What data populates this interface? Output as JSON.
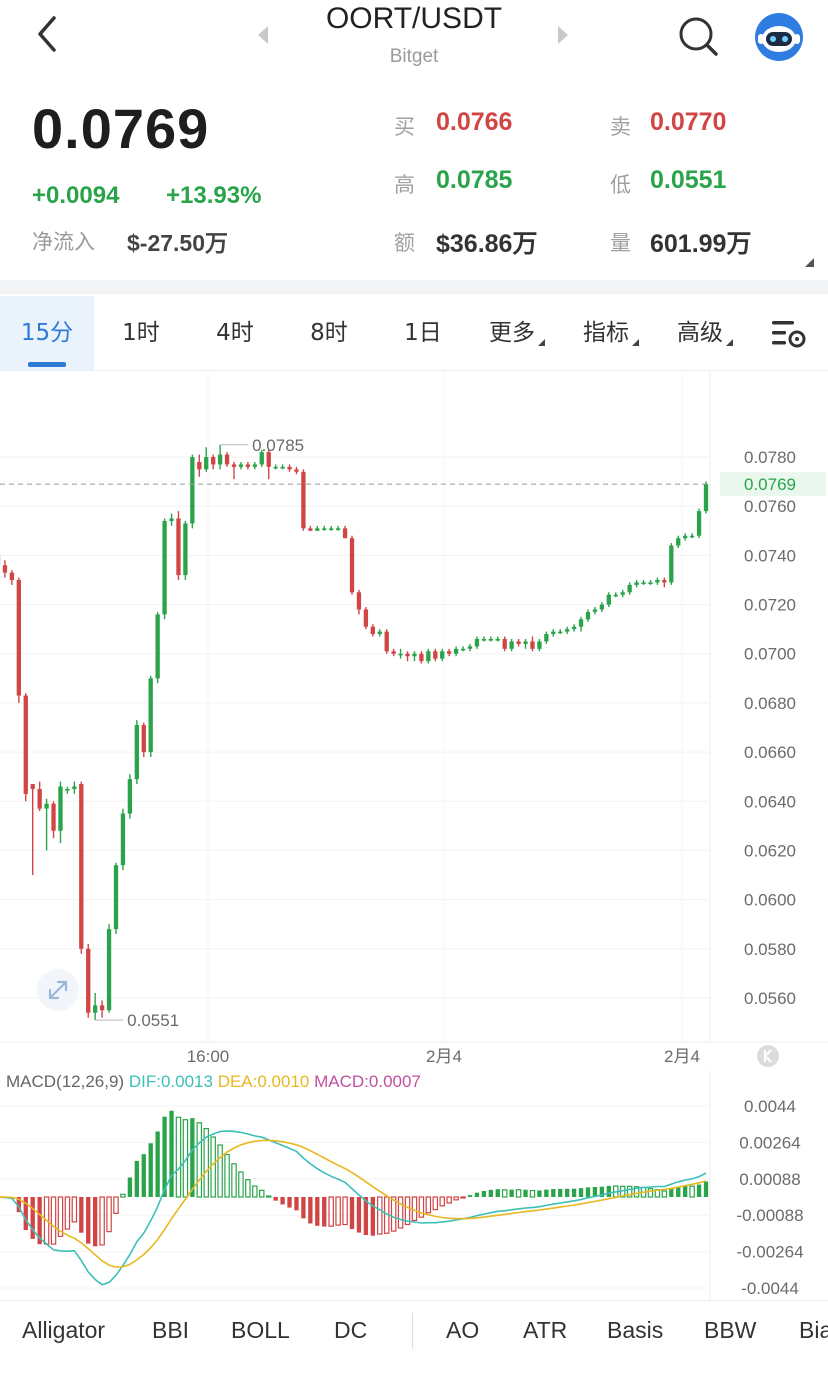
{
  "header": {
    "title": "OORT/USDT",
    "exchange": "Bitget"
  },
  "ticker": {
    "last_price": "0.0769",
    "change_abs": "+0.0094",
    "change_pct": "+13.93%",
    "netflow_label": "净流入",
    "netflow_value": "$-27.50万",
    "bid_label": "买",
    "bid_value": "0.0766",
    "ask_label": "卖",
    "ask_value": "0.0770",
    "high_label": "高",
    "high_value": "0.0785",
    "low_label": "低",
    "low_value": "0.0551",
    "turnover_label": "额",
    "turnover_value": "$36.86万",
    "volume_label": "量",
    "volume_value": "601.99万"
  },
  "tabs": [
    {
      "label": "15分",
      "active": true
    },
    {
      "label": "1时"
    },
    {
      "label": "4时"
    },
    {
      "label": "8时"
    },
    {
      "label": "1日"
    },
    {
      "label": "更多"
    },
    {
      "label": "指标"
    },
    {
      "label": "高级"
    }
  ],
  "colors": {
    "up": "#2aa44a",
    "down": "#d14545",
    "accent": "#2e7bd6",
    "dif": "#3cbfb8",
    "dea": "#e8b820",
    "macd": "#c050a0"
  },
  "chart_data": [
    {
      "type": "candlestick",
      "y_ticks": [
        "0.0780",
        "0.0760",
        "0.0740",
        "0.0720",
        "0.0700",
        "0.0680",
        "0.0660",
        "0.0640",
        "0.0620",
        "0.0600",
        "0.0580",
        "0.0560"
      ],
      "x_ticks": [
        "16:00",
        "2月4",
        "2月4"
      ],
      "ylim": [
        0.0549,
        0.0791
      ],
      "current_price_label": "0.0769",
      "high_marker": "0.0785",
      "low_marker": "0.0551",
      "candles": [
        [
          0.074,
          0.0742,
          0.0734,
          0.0736
        ],
        [
          0.0736,
          0.0738,
          0.0731,
          0.0733
        ],
        [
          0.0733,
          0.0734,
          0.0728,
          0.073
        ],
        [
          0.073,
          0.0731,
          0.068,
          0.0683
        ],
        [
          0.0683,
          0.0684,
          0.064,
          0.0643
        ],
        [
          0.0647,
          0.0647,
          0.061,
          0.0645
        ],
        [
          0.0645,
          0.0648,
          0.0636,
          0.0637
        ],
        [
          0.0637,
          0.0641,
          0.062,
          0.0639
        ],
        [
          0.0639,
          0.064,
          0.0625,
          0.0628
        ],
        [
          0.0628,
          0.0648,
          0.0623,
          0.0646
        ],
        [
          0.0645,
          0.0646,
          0.0643,
          0.0645
        ],
        [
          0.0645,
          0.0648,
          0.0643,
          0.0646
        ],
        [
          0.0647,
          0.0648,
          0.0578,
          0.058
        ],
        [
          0.058,
          0.0582,
          0.0552,
          0.0554
        ],
        [
          0.0554,
          0.0562,
          0.0551,
          0.0557
        ],
        [
          0.0557,
          0.0559,
          0.0552,
          0.0555
        ],
        [
          0.0555,
          0.059,
          0.0554,
          0.0588
        ],
        [
          0.0588,
          0.0615,
          0.0586,
          0.0614
        ],
        [
          0.0614,
          0.0637,
          0.0612,
          0.0635
        ],
        [
          0.0635,
          0.0651,
          0.0633,
          0.0649
        ],
        [
          0.0649,
          0.0673,
          0.0647,
          0.0671
        ],
        [
          0.0671,
          0.0672,
          0.0658,
          0.066
        ],
        [
          0.066,
          0.0691,
          0.0658,
          0.069
        ],
        [
          0.069,
          0.0717,
          0.0688,
          0.0716
        ],
        [
          0.0716,
          0.0755,
          0.0714,
          0.0754
        ],
        [
          0.0754,
          0.0757,
          0.0752,
          0.0755
        ],
        [
          0.0755,
          0.0758,
          0.073,
          0.0732
        ],
        [
          0.0732,
          0.0754,
          0.073,
          0.0753
        ],
        [
          0.0753,
          0.0781,
          0.0751,
          0.078
        ],
        [
          0.0778,
          0.0781,
          0.0772,
          0.0775
        ],
        [
          0.0775,
          0.0784,
          0.0774,
          0.078
        ],
        [
          0.078,
          0.0781,
          0.0775,
          0.0777
        ],
        [
          0.0777,
          0.0785,
          0.0775,
          0.0781
        ],
        [
          0.0781,
          0.0782,
          0.0776,
          0.0777
        ],
        [
          0.0777,
          0.0778,
          0.0771,
          0.0776
        ],
        [
          0.0776,
          0.0778,
          0.0775,
          0.0777
        ],
        [
          0.0777,
          0.0778,
          0.0775,
          0.0776
        ],
        [
          0.0776,
          0.0778,
          0.0775,
          0.0777
        ],
        [
          0.0777,
          0.0783,
          0.0776,
          0.0782
        ],
        [
          0.0782,
          0.0783,
          0.0771,
          0.0776
        ],
        [
          0.0776,
          0.0777,
          0.0775,
          0.0776
        ],
        [
          0.0776,
          0.0777,
          0.0775,
          0.0776
        ],
        [
          0.0776,
          0.0777,
          0.0774,
          0.0775
        ],
        [
          0.0775,
          0.0776,
          0.0773,
          0.0774
        ],
        [
          0.0774,
          0.0775,
          0.075,
          0.0751
        ],
        [
          0.0751,
          0.0752,
          0.075,
          0.075
        ],
        [
          0.075,
          0.0752,
          0.075,
          0.0751
        ],
        [
          0.0751,
          0.0752,
          0.075,
          0.0751
        ],
        [
          0.0751,
          0.0752,
          0.075,
          0.0751
        ],
        [
          0.0751,
          0.0752,
          0.075,
          0.0751
        ],
        [
          0.0751,
          0.0752,
          0.0747,
          0.0747
        ],
        [
          0.0747,
          0.0748,
          0.0724,
          0.0725
        ],
        [
          0.0725,
          0.0726,
          0.0716,
          0.0718
        ],
        [
          0.0718,
          0.0719,
          0.071,
          0.0711
        ],
        [
          0.0711,
          0.0712,
          0.0707,
          0.0708
        ],
        [
          0.0708,
          0.071,
          0.0707,
          0.0709
        ],
        [
          0.0709,
          0.071,
          0.07,
          0.0701
        ],
        [
          0.0701,
          0.0702,
          0.0699,
          0.07
        ],
        [
          0.07,
          0.0702,
          0.0698,
          0.07
        ],
        [
          0.07,
          0.0701,
          0.0697,
          0.0699
        ],
        [
          0.0699,
          0.0701,
          0.0697,
          0.07
        ],
        [
          0.07,
          0.0701,
          0.0696,
          0.0697
        ],
        [
          0.0697,
          0.0702,
          0.0696,
          0.0701
        ],
        [
          0.0701,
          0.0702,
          0.0697,
          0.0698
        ],
        [
          0.0698,
          0.0702,
          0.0697,
          0.0701
        ],
        [
          0.0701,
          0.0702,
          0.0699,
          0.07
        ],
        [
          0.07,
          0.0703,
          0.0699,
          0.0702
        ],
        [
          0.0702,
          0.0703,
          0.0701,
          0.0702
        ],
        [
          0.0702,
          0.0704,
          0.0701,
          0.0703
        ],
        [
          0.0703,
          0.0707,
          0.0702,
          0.0706
        ],
        [
          0.0706,
          0.0707,
          0.0705,
          0.0706
        ],
        [
          0.0706,
          0.0707,
          0.0705,
          0.0706
        ],
        [
          0.0706,
          0.0707,
          0.0705,
          0.0706
        ],
        [
          0.0706,
          0.0707,
          0.0701,
          0.0702
        ],
        [
          0.0702,
          0.0706,
          0.0701,
          0.0705
        ],
        [
          0.0705,
          0.0706,
          0.0703,
          0.0704
        ],
        [
          0.0704,
          0.0706,
          0.0702,
          0.0705
        ],
        [
          0.0705,
          0.0707,
          0.0701,
          0.0702
        ],
        [
          0.0702,
          0.0706,
          0.0701,
          0.0705
        ],
        [
          0.0705,
          0.0709,
          0.0704,
          0.0708
        ],
        [
          0.0708,
          0.071,
          0.0707,
          0.0709
        ],
        [
          0.0709,
          0.071,
          0.0708,
          0.0709
        ],
        [
          0.0709,
          0.0711,
          0.0708,
          0.071
        ],
        [
          0.071,
          0.0712,
          0.0709,
          0.0711
        ],
        [
          0.0711,
          0.0715,
          0.0709,
          0.0714
        ],
        [
          0.0714,
          0.0718,
          0.0713,
          0.0717
        ],
        [
          0.0717,
          0.0719,
          0.0716,
          0.0718
        ],
        [
          0.0718,
          0.0721,
          0.0717,
          0.072
        ],
        [
          0.072,
          0.0725,
          0.0719,
          0.0724
        ],
        [
          0.0724,
          0.0725,
          0.0723,
          0.0724
        ],
        [
          0.0724,
          0.0726,
          0.0723,
          0.0725
        ],
        [
          0.0725,
          0.0729,
          0.0724,
          0.0728
        ],
        [
          0.0728,
          0.073,
          0.0727,
          0.0729
        ],
        [
          0.0729,
          0.073,
          0.0728,
          0.0729
        ],
        [
          0.0729,
          0.073,
          0.0728,
          0.0729
        ],
        [
          0.0729,
          0.0731,
          0.0728,
          0.073
        ],
        [
          0.073,
          0.0731,
          0.0727,
          0.0729
        ],
        [
          0.0729,
          0.0745,
          0.0728,
          0.0744
        ],
        [
          0.0744,
          0.0748,
          0.0743,
          0.0747
        ],
        [
          0.0747,
          0.0749,
          0.0746,
          0.0748
        ],
        [
          0.0748,
          0.0749,
          0.0747,
          0.0748
        ],
        [
          0.0748,
          0.0759,
          0.0747,
          0.0758
        ],
        [
          0.0758,
          0.077,
          0.0757,
          0.0769
        ]
      ]
    },
    {
      "type": "macd",
      "title": "MACD(12,26,9)",
      "dif_label": "DIF:0.0013",
      "dea_label": "DEA:0.0010",
      "macd_label": "MACD:0.0007",
      "y_ticks": [
        "0.0044",
        "0.00264",
        "0.00088",
        "-0.00088",
        "-0.00264",
        "-0.0044"
      ],
      "ylim": [
        -0.0044,
        0.0044
      ]
    }
  ],
  "indicators": [
    "Alligator",
    "BBI",
    "BOLL",
    "DC",
    "AO",
    "ATR",
    "Basis",
    "BBW",
    "Bia"
  ]
}
